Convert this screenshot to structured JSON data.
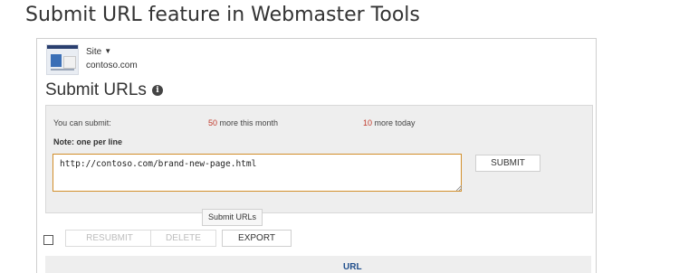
{
  "page_heading": "Submit URL feature in Webmaster Tools",
  "site": {
    "selector_label": "Site",
    "domain": "contoso.com",
    "thumbnail_icon": "site-thumbnail-icon"
  },
  "panel": {
    "title": "Submit URLs",
    "info_icon": "info-icon"
  },
  "quota": {
    "label": "You can submit:",
    "month_count": "50",
    "month_text": " more this month",
    "today_count": "10",
    "today_text": " more today"
  },
  "note": "Note: one per line",
  "url_input": {
    "value": "http://contoso.com/brand-new-page.html"
  },
  "buttons": {
    "submit": "SUBMIT",
    "resubmit": "RESUBMIT",
    "delete": "DELETE",
    "export": "EXPORT"
  },
  "tooltip": "Submit URLs",
  "table": {
    "columns": [
      "URL"
    ]
  },
  "colors": {
    "accent_count": "#c0392b",
    "input_focus_border": "#d28e2a",
    "column_header": "#1f4e8c"
  }
}
